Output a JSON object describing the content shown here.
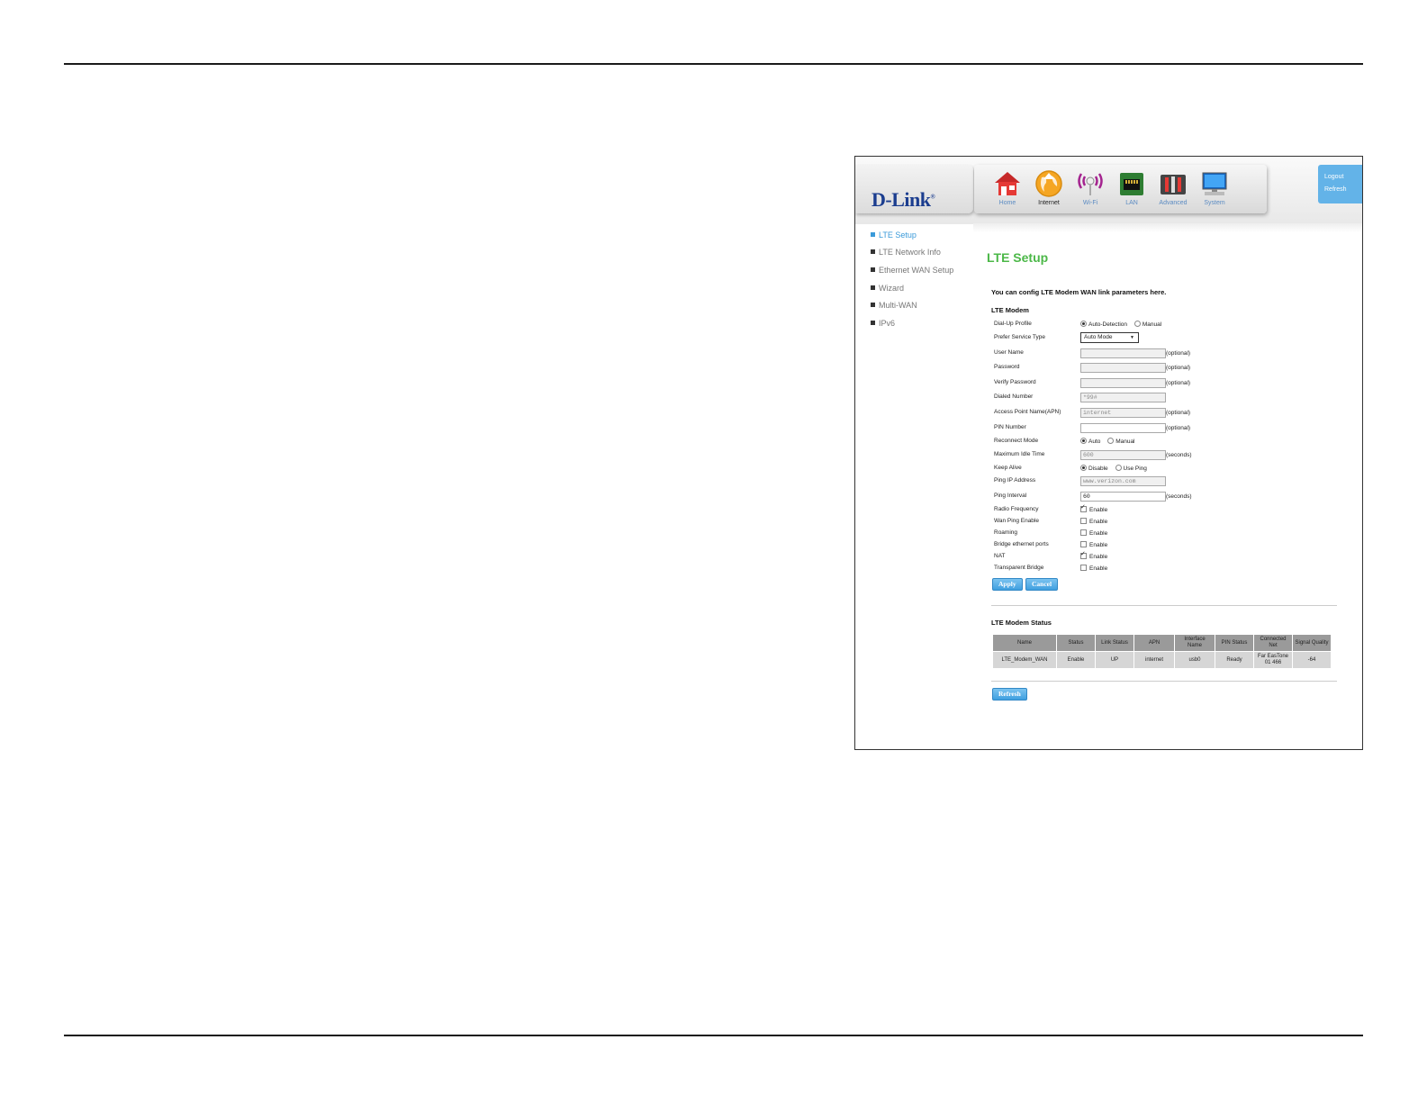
{
  "header": {
    "logo": "D-Link",
    "nav": [
      {
        "label": "Home",
        "icon": "home-icon",
        "active": false
      },
      {
        "label": "Internet",
        "icon": "globe-icon",
        "active": true
      },
      {
        "label": "Wi-Fi",
        "icon": "wifi-icon",
        "active": false
      },
      {
        "label": "LAN",
        "icon": "lan-icon",
        "active": false
      },
      {
        "label": "Advanced",
        "icon": "tools-icon",
        "active": false
      },
      {
        "label": "System",
        "icon": "monitor-icon",
        "active": false
      }
    ],
    "logout": "Logout",
    "refresh": "Refresh"
  },
  "sidebar": {
    "items": [
      {
        "label": "LTE Setup",
        "active": true
      },
      {
        "label": "LTE Network Info",
        "active": false
      },
      {
        "label": "Ethernet WAN Setup",
        "active": false
      },
      {
        "label": "Wizard",
        "active": false
      },
      {
        "label": "Multi-WAN",
        "active": false
      },
      {
        "label": "IPv6",
        "active": false
      }
    ]
  },
  "main": {
    "title": "LTE Setup",
    "intro": "You can config LTE Modem WAN link parameters here.",
    "modem_section": "LTE Modem",
    "fields": {
      "dialup_profile": {
        "label": "Dial-Up Profile",
        "option1": "Auto-Detection",
        "option2": "Manual",
        "selected": "Auto-Detection"
      },
      "prefer_service": {
        "label": "Prefer Service Type",
        "value": "Auto Mode"
      },
      "user_name": {
        "label": "User Name",
        "value": "",
        "note": "(optional)"
      },
      "password": {
        "label": "Password",
        "value": "",
        "note": "(optional)"
      },
      "verify_password": {
        "label": "Verify Password",
        "value": "",
        "note": "(optional)"
      },
      "dialed_number": {
        "label": "Dialed Number",
        "value": "*99#"
      },
      "apn": {
        "label": "Access Point Name(APN)",
        "value": "internet",
        "note": "(optional)"
      },
      "pin": {
        "label": "PIN Number",
        "value": "",
        "note": "(optional)"
      },
      "reconnect_mode": {
        "label": "Reconnect Mode",
        "option1": "Auto",
        "option2": "Manual",
        "selected": "Auto"
      },
      "max_idle": {
        "label": "Maximum Idle Time",
        "value": "600",
        "note": "(seconds)"
      },
      "keep_alive": {
        "label": "Keep Alive",
        "option1": "Disable",
        "option2": "Use Ping",
        "selected": "Disable"
      },
      "ping_ip": {
        "label": "Ping IP Address",
        "value": "www.verizon.com"
      },
      "ping_interval": {
        "label": "Ping Interval",
        "value": "60",
        "note": "(seconds)"
      },
      "radio_frequency": {
        "label": "Radio Frequency",
        "option": "Enable",
        "checked": true
      },
      "wan_ping": {
        "label": "Wan Ping Enable",
        "option": "Enable",
        "checked": false
      },
      "roaming": {
        "label": "Roaming",
        "option": "Enable",
        "checked": false
      },
      "bridge_ports": {
        "label": "Bridge ethernet ports",
        "option": "Enable",
        "checked": false
      },
      "nat": {
        "label": "NAT",
        "option": "Enable",
        "checked": true
      },
      "transparent_bridge": {
        "label": "Transparent Bridge",
        "option": "Enable",
        "checked": false
      }
    },
    "apply": "Apply",
    "cancel": "Cancel",
    "status_section": "LTE Modem Status",
    "status_table": {
      "headers": [
        "Name",
        "Status",
        "Link Status",
        "APN",
        "Interface Name",
        "PIN Status",
        "Connected Net",
        "Signal Quality"
      ],
      "rows": [
        [
          "LTE_Modem_WAN",
          "Enable",
          "UP",
          "internet",
          "usb0",
          "Ready",
          "Far EasTone 01 466",
          "-64"
        ]
      ]
    },
    "refresh_button": "Refresh"
  }
}
